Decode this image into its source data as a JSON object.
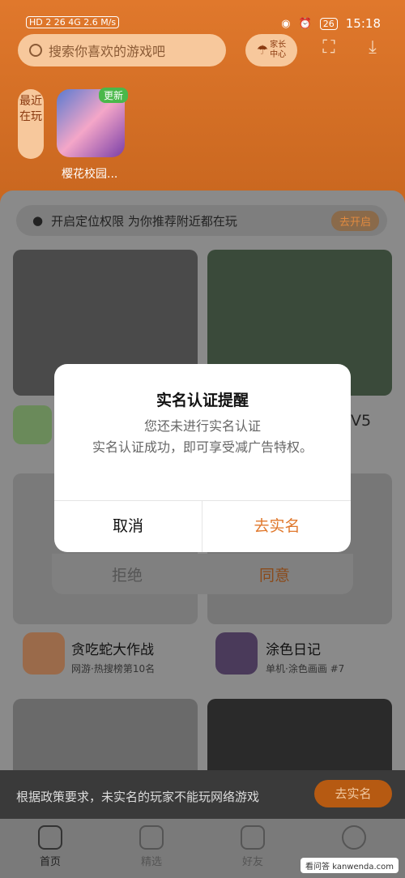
{
  "status": {
    "left": "HD 2 26 4G 2.6 M/s",
    "battery": "26",
    "time": "15:18"
  },
  "search": {
    "placeholder": "搜索你喜欢的游戏吧"
  },
  "guard": {
    "label": "家长\n中心"
  },
  "recent": {
    "tag": "最近在玩",
    "game_name": "樱花校园...",
    "update_badge": "更新"
  },
  "location": {
    "text": "开启定位权限 为你推荐附近都在玩",
    "action": "去开启"
  },
  "underlay": {
    "reject": "拒绝",
    "agree": "同意"
  },
  "games": [
    {
      "name": "贪吃蛇大作战",
      "meta": "网游·热搜榜第10名"
    },
    {
      "name": "涂色日记",
      "meta": "单机·涂色画画 #7"
    }
  ],
  "behind_label": "V5",
  "banner": {
    "text": "根据政策要求，未实名的玩家不能玩网络游戏",
    "button": "去实名"
  },
  "nav": [
    {
      "label": "首页"
    },
    {
      "label": "精选"
    },
    {
      "label": "好友"
    },
    {
      "label": ""
    }
  ],
  "dialog": {
    "title": "实名认证提醒",
    "line1": "您还未进行实名认证",
    "line2": "实名认证成功，即可享受减广告特权。",
    "cancel": "取消",
    "confirm": "去实名"
  },
  "watermark": "看问答 kanwenda.com",
  "colors": {
    "accent": "#e0782c",
    "confirm": "#e0782c"
  }
}
